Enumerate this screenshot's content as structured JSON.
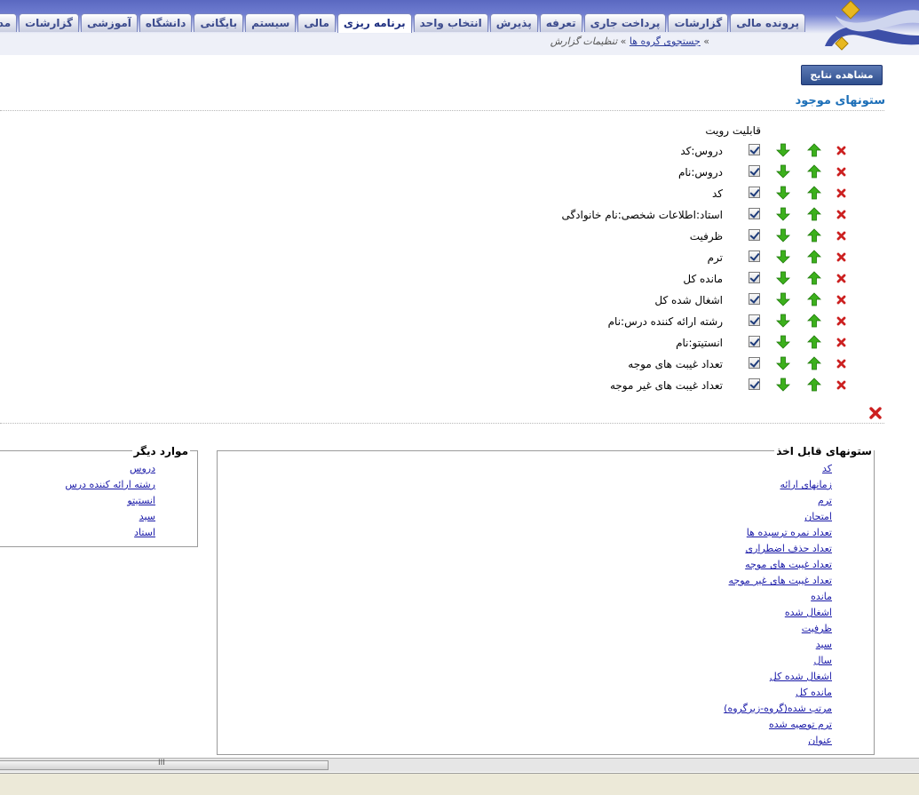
{
  "header": {
    "tabs": [
      "پرونده مالی",
      "گزارشات",
      "پرداخت جاری",
      "تعرفه",
      "پذیرش",
      "انتخاب واحد",
      "برنامه ریزی",
      "مالی",
      "سیستم",
      "بایگانی",
      "دانشگاه",
      "آموزشی",
      "گزارشات",
      "مدیریت نمرات"
    ],
    "active_tab_index": 6,
    "breadcrumb_link": "جستجوی گروه ها",
    "breadcrumb_current": "تنظیمات گزارش",
    "breadcrumb_sep_1": "»",
    "breadcrumb_sep_2": "»"
  },
  "toolbar": {
    "view_results_label": "مشاهده نتایج"
  },
  "existing": {
    "title": "ستونهای موجود",
    "visibility_header": "قابلیت رویت",
    "rows": [
      {
        "label": "دروس:کد",
        "visible": true
      },
      {
        "label": "دروس:نام",
        "visible": true
      },
      {
        "label": "کد",
        "visible": true
      },
      {
        "label": "استاد:اطلاعات شخصی:نام خانوادگی",
        "visible": true
      },
      {
        "label": "ظرفیت",
        "visible": true
      },
      {
        "label": "ترم",
        "visible": true
      },
      {
        "label": "مانده کل",
        "visible": true
      },
      {
        "label": "اشغال شده کل",
        "visible": true
      },
      {
        "label": "رشته ارائه کننده درس:نام",
        "visible": true
      },
      {
        "label": "انستیتو:نام",
        "visible": true
      },
      {
        "label": "تعداد غیبت های موجه",
        "visible": true
      },
      {
        "label": "تعداد غیبت های غیر موجه",
        "visible": true
      }
    ],
    "icons": {
      "up": "arrow-up-icon",
      "down": "arrow-down-icon",
      "delete": "delete-icon"
    },
    "colors": {
      "arrow": "#3cb01c",
      "delete": "#cc2020",
      "title": "#1c6fb8"
    }
  },
  "available": {
    "legend": "ستونهای قابل اخذ",
    "links": [
      "کد",
      "زمانهای ارائه",
      "ترم",
      "امتحان",
      "تعداد نمره ترسیده ها",
      "تعداد حذف اضطراری",
      "تعداد غیبت های موجه",
      "تعداد غیبت های غیر موجه",
      "مانده",
      "اشغال شده",
      "ظرفیت",
      "سید",
      "سال",
      "اشغال شده کل",
      "مانده کل",
      "مرتب شده(گروه-زیرگروه)",
      "ترم توصیه شده",
      "عنوان"
    ]
  },
  "other": {
    "legend": "موارد دیگر",
    "links": [
      "دروس",
      "رشته ارائه کننده درس",
      "انستیتو",
      "سید",
      "استاد"
    ]
  },
  "scrollbar_grip": "III"
}
